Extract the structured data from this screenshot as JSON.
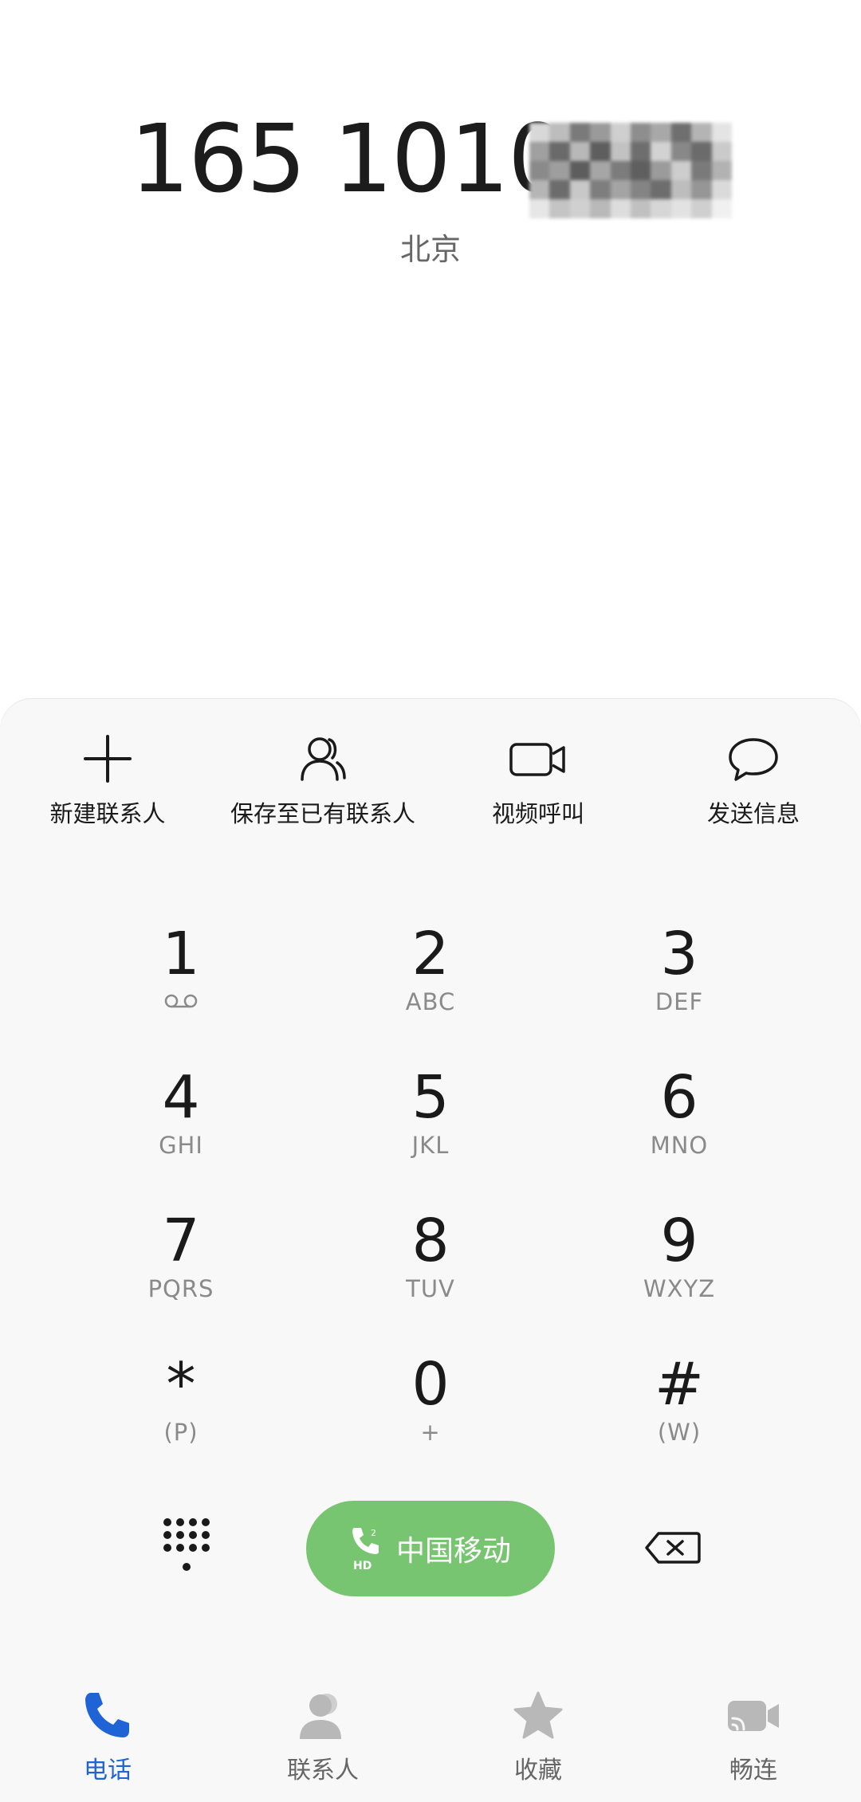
{
  "number": {
    "visible": "165 1010",
    "location": "北京"
  },
  "actions": [
    {
      "label": "新建联系人",
      "icon": "plus-icon"
    },
    {
      "label": "保存至已有联系人",
      "icon": "contact-icon"
    },
    {
      "label": "视频呼叫",
      "icon": "video-camera-icon"
    },
    {
      "label": "发送信息",
      "icon": "message-bubble-icon"
    }
  ],
  "keypad": [
    {
      "digit": "1",
      "sub": ""
    },
    {
      "digit": "2",
      "sub": "ABC"
    },
    {
      "digit": "3",
      "sub": "DEF"
    },
    {
      "digit": "4",
      "sub": "GHI"
    },
    {
      "digit": "5",
      "sub": "JKL"
    },
    {
      "digit": "6",
      "sub": "MNO"
    },
    {
      "digit": "7",
      "sub": "PQRS"
    },
    {
      "digit": "8",
      "sub": "TUV"
    },
    {
      "digit": "9",
      "sub": "WXYZ"
    },
    {
      "digit": "*",
      "sub": "(P)"
    },
    {
      "digit": "0",
      "sub": "+"
    },
    {
      "digit": "#",
      "sub": "(W)"
    }
  ],
  "call": {
    "carrier": "中国移动",
    "accent": "#78c571",
    "hd_badge": "HD",
    "sim": "2"
  },
  "tabs": [
    {
      "label": "电话",
      "icon": "phone-icon",
      "active": true
    },
    {
      "label": "联系人",
      "icon": "person-icon",
      "active": false
    },
    {
      "label": "收藏",
      "icon": "star-icon",
      "active": false
    },
    {
      "label": "畅连",
      "icon": "video-chat-icon",
      "active": false
    }
  ],
  "colors": {
    "active_tab": "#1e64d6",
    "inactive": "#b8b8b8"
  }
}
